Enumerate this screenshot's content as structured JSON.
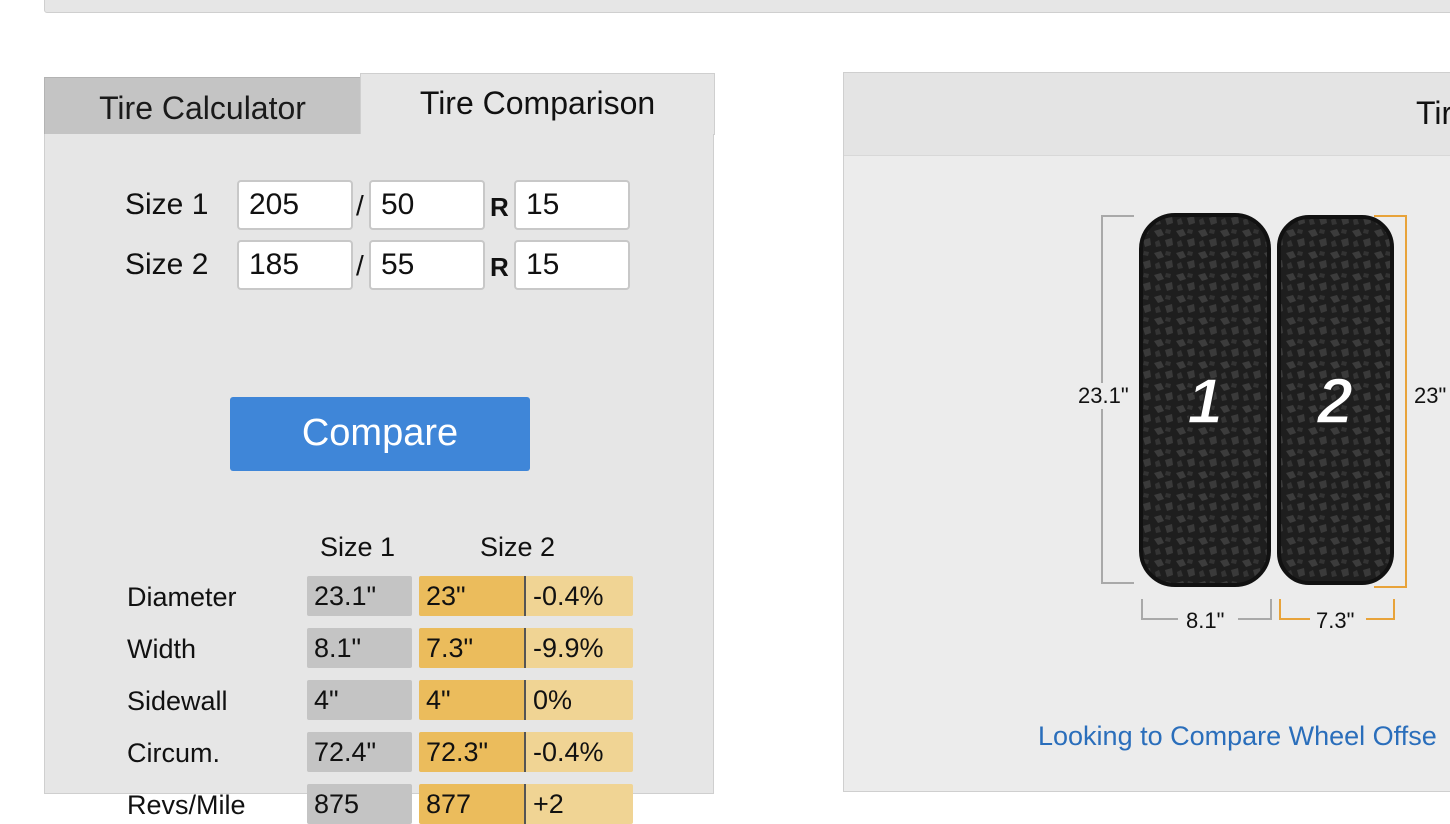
{
  "tabs": {
    "calculator": "Tire Calculator",
    "comparison": "Tire Comparison"
  },
  "inputs": {
    "size1": {
      "label": "Size 1",
      "width": "205",
      "aspect": "50",
      "rim": "15"
    },
    "size2": {
      "label": "Size 2",
      "width": "185",
      "aspect": "55",
      "rim": "15"
    },
    "slash": "/",
    "r": "R"
  },
  "compare_button": "Compare",
  "results": {
    "header": {
      "size1": "Size 1",
      "size2": "Size 2"
    },
    "rows": [
      {
        "label": "Diameter",
        "s1": "23.1\"",
        "s2": "23\"",
        "diff": "-0.4%"
      },
      {
        "label": "Width",
        "s1": "8.1\"",
        "s2": "7.3\"",
        "diff": "-9.9%"
      },
      {
        "label": "Sidewall",
        "s1": "4\"",
        "s2": "4\"",
        "diff": "0%"
      },
      {
        "label": "Circum.",
        "s1": "72.4\"",
        "s2": "72.3\"",
        "diff": "-0.4%"
      },
      {
        "label": "Revs/Mile",
        "s1": "875",
        "s2": "877",
        "diff": "+2"
      }
    ]
  },
  "visual": {
    "title": "Tir",
    "tire1": {
      "number": "1",
      "diameter": "23.1\"",
      "width": "8.1\""
    },
    "tire2": {
      "number": "2",
      "diameter": "23\"",
      "width": "7.3\""
    },
    "link": "Looking to Compare Wheel Offse"
  },
  "colors": {
    "button_blue": "#3f86d8",
    "size1_cell": "#c4c4c4",
    "size2_cell": "#ebbc5c",
    "diff_cell": "#f0d494",
    "tire2_accent": "#e8a33a",
    "link": "#2a6ebb"
  }
}
